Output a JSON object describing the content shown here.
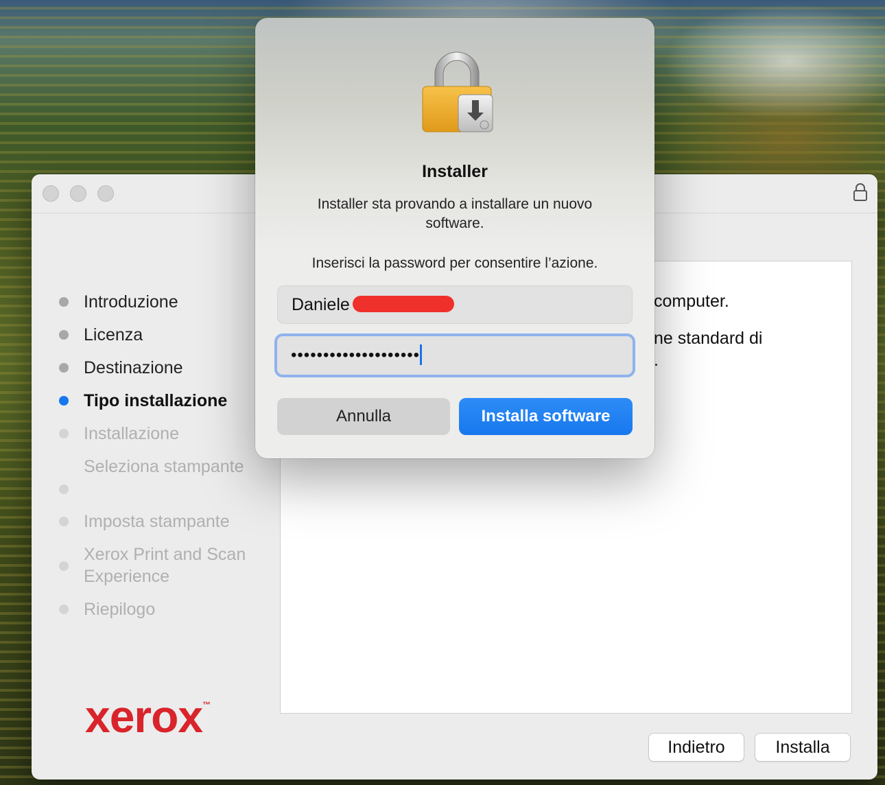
{
  "installer_window": {
    "steps": [
      {
        "label": "Introduzione",
        "state": "done"
      },
      {
        "label": "Licenza",
        "state": "done"
      },
      {
        "label": "Destinazione",
        "state": "done"
      },
      {
        "label": "Tipo installazione",
        "state": "current"
      },
      {
        "label": "Installazione",
        "state": "future"
      },
      {
        "label": "Seleziona stampante",
        "state": "future"
      },
      {
        "label": "Imposta stampante",
        "state": "future"
      },
      {
        "label": "Xerox Print and Scan Experience",
        "state": "future"
      },
      {
        "label": "Riepilogo",
        "state": "future"
      }
    ],
    "logo_text": "xerox",
    "logo_tm": "™",
    "content": {
      "line1": "computer.",
      "line2": "ne standard di",
      "line3": "."
    },
    "back_button": "Indietro",
    "install_button": "Installa",
    "lock_icon": "lock-icon"
  },
  "auth_dialog": {
    "icon": "lock-installer-icon",
    "title": "Installer",
    "message": "Installer sta provando a installare un nuovo software.",
    "prompt": "Inserisci la password per consentire l’azione.",
    "username": "Daniele",
    "password_mask": "••••••••••••••••••••",
    "cancel_label": "Annulla",
    "confirm_label": "Installa software"
  },
  "colors": {
    "accent": "#1778ee",
    "xerox_red": "#d9242b",
    "current_step_dot": "#1677ef"
  }
}
